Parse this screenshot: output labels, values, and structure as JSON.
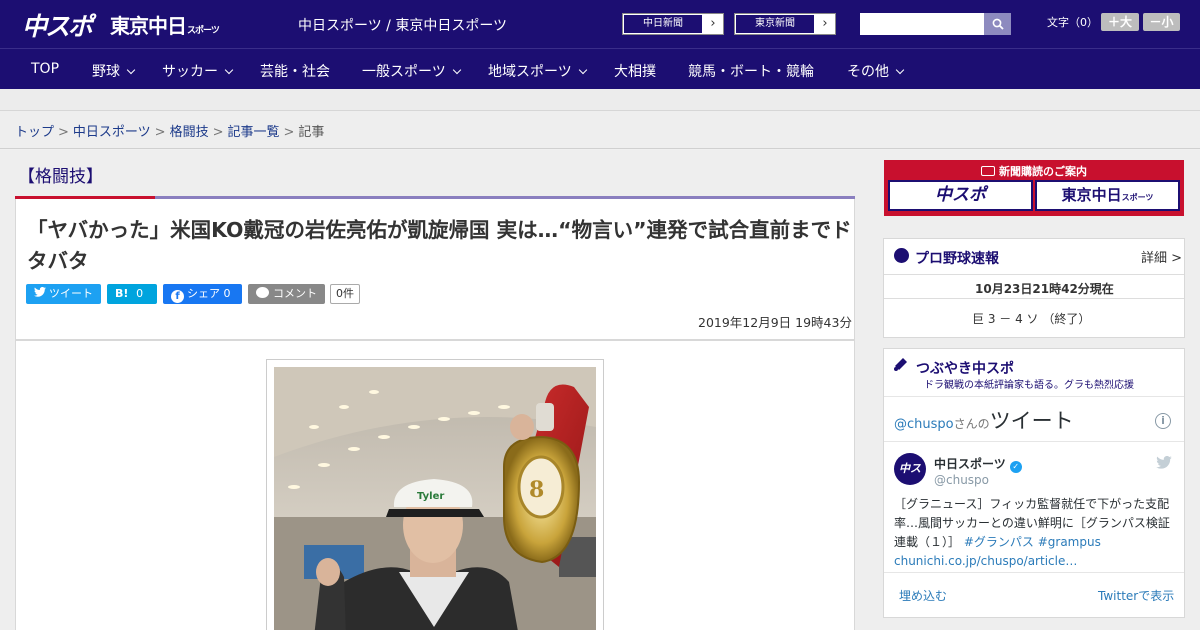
{
  "header": {
    "logo_chuspo": "中スポ",
    "logo_tokyo": "東京中日",
    "logo_tokyo_small": "スポーツ",
    "site_title": "中日スポーツ / 東京中日スポーツ",
    "ext_links": [
      {
        "label": "中日新聞"
      },
      {
        "label": "東京新聞"
      }
    ],
    "search_placeholder": "",
    "font_size_label": "文字（0）",
    "font_plus": "＋大",
    "font_minus": "－小"
  },
  "nav": {
    "items": [
      {
        "label": "TOP",
        "dropdown": false
      },
      {
        "label": "野球",
        "dropdown": true
      },
      {
        "label": "サッカー",
        "dropdown": true
      },
      {
        "label": "芸能・社会",
        "dropdown": false
      },
      {
        "label": "一般スポーツ",
        "dropdown": true
      },
      {
        "label": "地域スポーツ",
        "dropdown": true
      },
      {
        "label": "大相撲",
        "dropdown": false
      },
      {
        "label": "競馬・ボート・競輪",
        "dropdown": false
      },
      {
        "label": "その他",
        "dropdown": true
      }
    ]
  },
  "breadcrumb": {
    "items": [
      "トップ",
      "中日スポーツ",
      "格闘技",
      "記事一覧"
    ],
    "current": "記事",
    "separator": ">"
  },
  "article": {
    "category": "【格闘技】",
    "headline": "「ヤバかった」米国KO戴冠の岩佐亮佑が凱旋帰国 実は…“物言い”連発で試合直前までドタバタ",
    "share": {
      "tweet": "ツイート",
      "hatena": "B!",
      "hatena_count": "0",
      "facebook": "シェア",
      "facebook_count": "0",
      "comment": "コメント",
      "comment_count": "0件"
    },
    "date": "2019年12月9日 19時43分"
  },
  "sidebar": {
    "promo": {
      "title": "新聞購読のご案内",
      "logo_left": "中スポ",
      "logo_right": "東京中日",
      "logo_right_small": "スポーツ"
    },
    "baseball": {
      "title": "プロ野球速報",
      "detail": "詳細 >",
      "timestamp": "10月23日21時42分現在",
      "score": "巨 3 － 4 ソ （終了）"
    },
    "tsubuyaki": {
      "title": "つぶやき中スポ",
      "subtitle": "ドラ観戦の本紙評論家も語る。グラも熱烈応援",
      "tweets_by_user": "@chuspo",
      "tweets_by_suffix": "さんの",
      "tweets_by_title": "ツイート",
      "account_name": "中日スポーツ",
      "account_handle": "@chuspo",
      "tweet_text": "［グラニュース］フィッカ監督就任で下がった支配率…風間サッカーとの違い鮮明に［グランパス検証連載（１）］",
      "tweet_tags": "#グランパス #grampus",
      "tweet_link": "chunichi.co.jp/chuspo/article…",
      "embed": "埋め込む",
      "view_on_twitter": "Twitterで表示"
    }
  },
  "colors": {
    "brand": "#1c0e72",
    "accent_red": "#c8102e",
    "twitter": "#1da1f2",
    "hatena": "#00a4de",
    "facebook": "#1877f2"
  }
}
